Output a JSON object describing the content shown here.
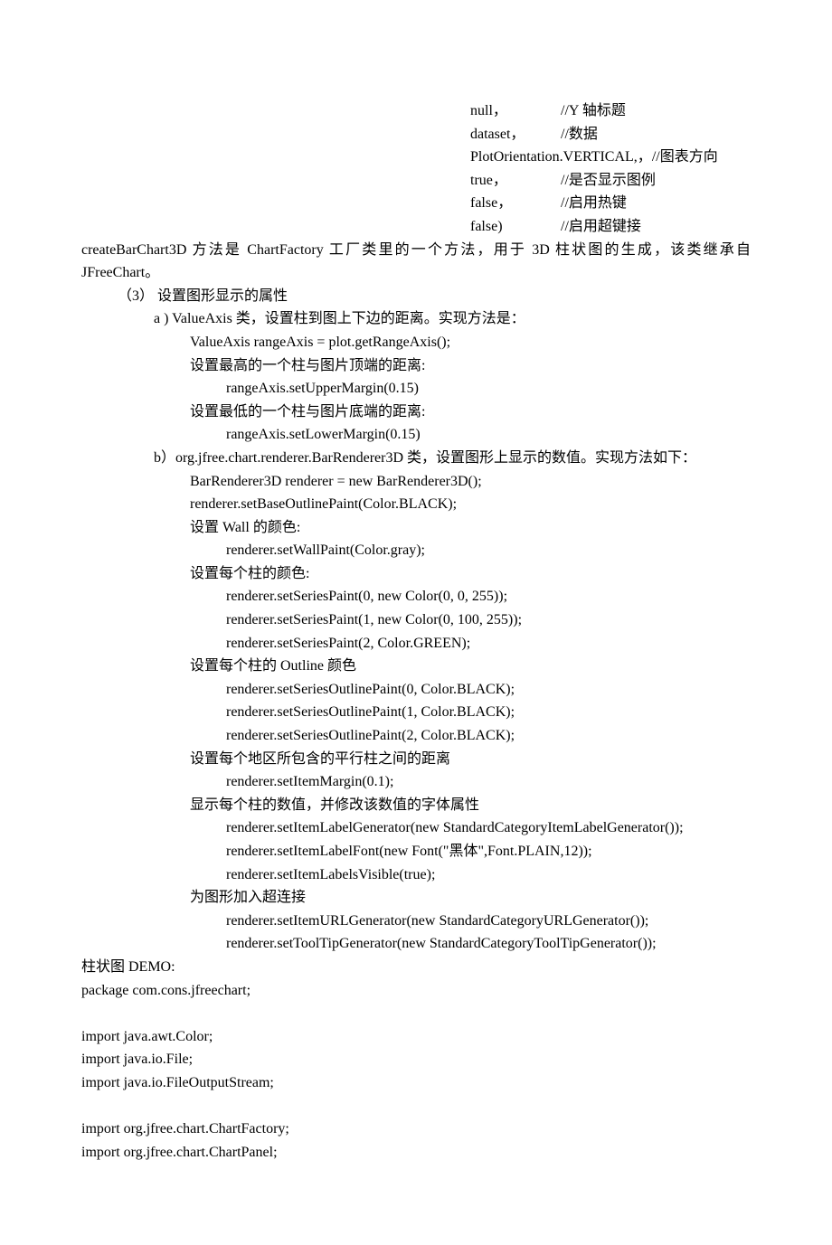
{
  "params": [
    {
      "arg": "null，",
      "comment": "//Y 轴标题"
    },
    {
      "arg": "dataset，",
      "comment": "//数据"
    },
    {
      "arg": "PlotOrientation.VERTICAL,，",
      "comment": "//图表方向"
    },
    {
      "arg": "true，",
      "comment": "//是否显示图例"
    },
    {
      "arg": "false，",
      "comment": "//启用热键"
    },
    {
      "arg": "false)",
      "comment": "//启用超键接"
    }
  ],
  "desc": "createBarChart3D 方法是 ChartFactory 工厂类里的一个方法，用于 3D 柱状图的生成，该类继承自JFreeChart。",
  "section3_title": "（3）  设置图形显示的属性",
  "a_title": "a ) ValueAxis 类，设置柱到图上下边的距离。实现方法是：",
  "a_lines": [
    "ValueAxis rangeAxis = plot.getRangeAxis();",
    "设置最高的一个柱与图片顶端的距离:",
    "    rangeAxis.setUpperMargin(0.15)",
    "设置最低的一个柱与图片底端的距离:",
    "    rangeAxis.setLowerMargin(0.15)"
  ],
  "b_title": "b）org.jfree.chart.renderer.BarRenderer3D 类，设置图形上显示的数值。实现方法如下：",
  "b_blocks": [
    {
      "head": null,
      "lines": [
        "BarRenderer3D renderer = new BarRenderer3D();",
        "renderer.setBaseOutlinePaint(Color.BLACK);"
      ]
    },
    {
      "head": "设置  Wall  的颜色:",
      "lines": [
        "renderer.setWallPaint(Color.gray);"
      ]
    },
    {
      "head": "设置每个柱的颜色:",
      "lines": [
        "renderer.setSeriesPaint(0, new Color(0, 0, 255));",
        "renderer.setSeriesPaint(1, new Color(0, 100, 255));",
        "renderer.setSeriesPaint(2, Color.GREEN);"
      ]
    },
    {
      "head": "设置每个柱的  Outline  颜色",
      "lines": [
        "renderer.setSeriesOutlinePaint(0, Color.BLACK);",
        "renderer.setSeriesOutlinePaint(1, Color.BLACK);",
        "renderer.setSeriesOutlinePaint(2, Color.BLACK);"
      ]
    },
    {
      "head": "设置每个地区所包含的平行柱之间的距离",
      "lines": [
        "renderer.setItemMargin(0.1);"
      ]
    },
    {
      "head": "显示每个柱的数值，并修改该数值的字体属性",
      "lines": [
        "renderer.setItemLabelGenerator(new StandardCategoryItemLabelGenerator());",
        "renderer.setItemLabelFont(new Font(\"黑体\",Font.PLAIN,12));",
        "renderer.setItemLabelsVisible(true);"
      ]
    },
    {
      "head": "为图形加入超连接",
      "lines": [
        "renderer.setItemURLGenerator(new StandardCategoryURLGenerator());",
        "renderer.setToolTipGenerator(new StandardCategoryToolTipGenerator());"
      ]
    }
  ],
  "demo_title": "柱状图 DEMO:",
  "demo_lines": [
    "package com.cons.jfreechart;",
    "",
    "import java.awt.Color;",
    "import java.io.File;",
    "import java.io.FileOutputStream;",
    "",
    "import org.jfree.chart.ChartFactory;",
    "import org.jfree.chart.ChartPanel;"
  ]
}
